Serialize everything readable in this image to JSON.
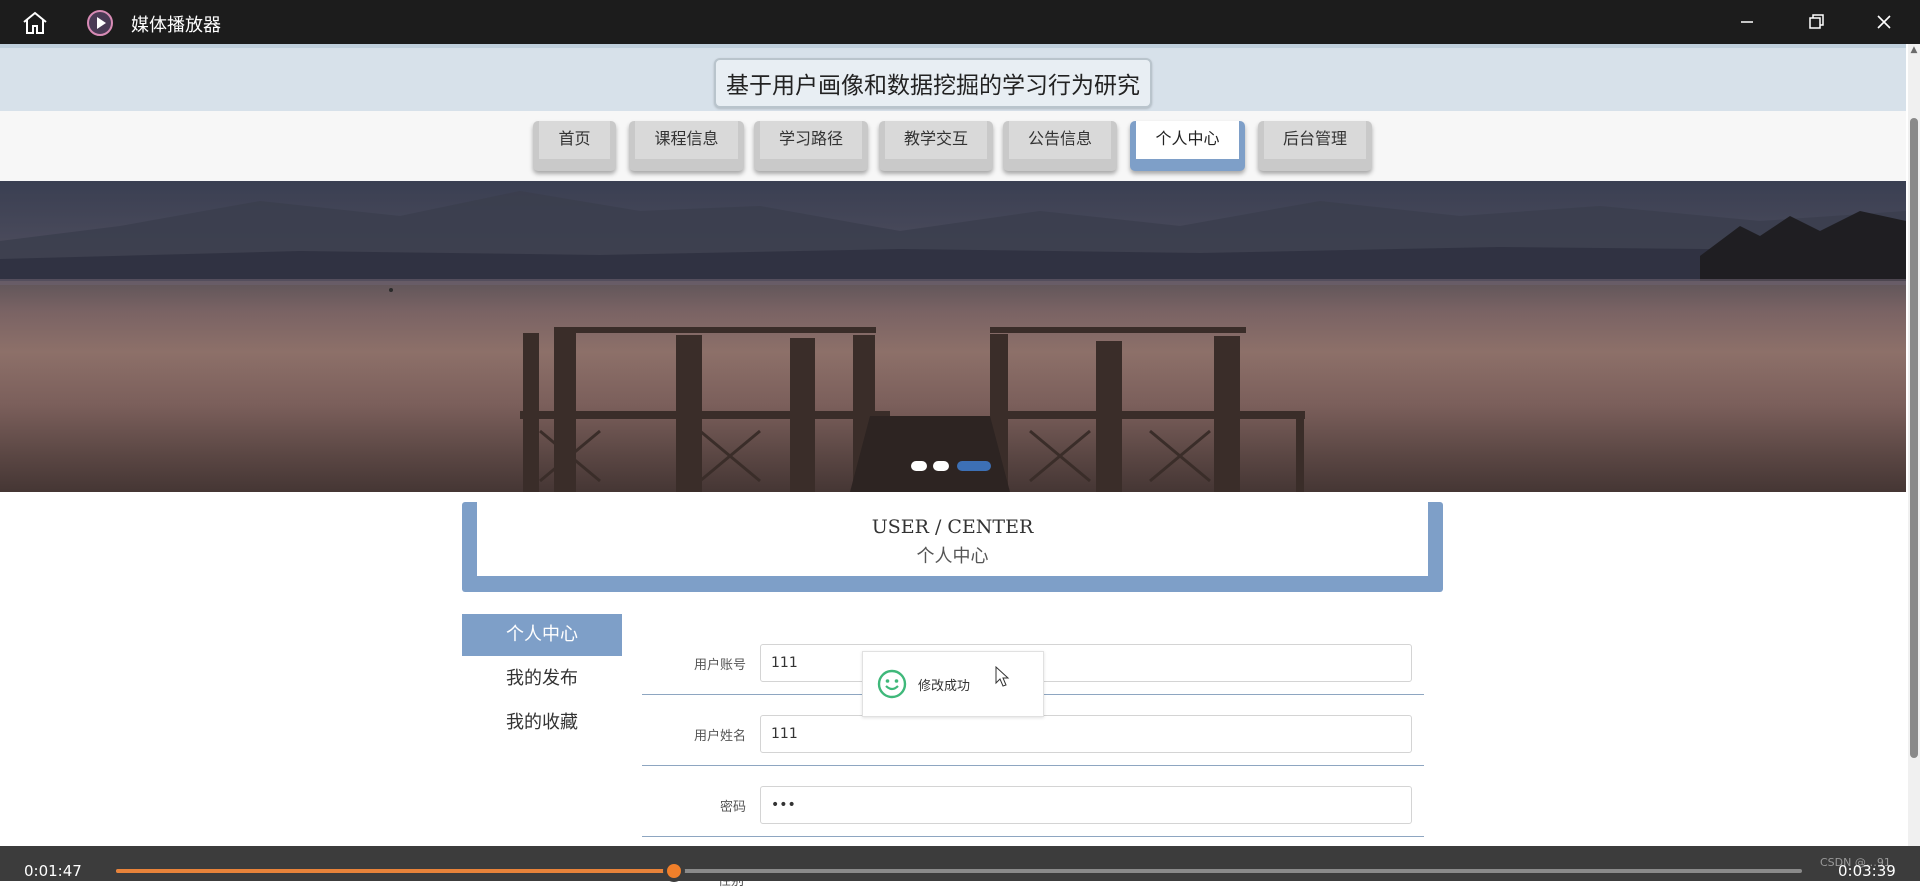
{
  "window": {
    "title": "媒体播放器",
    "home_icon": "home-icon",
    "app_icon": "media-player-icon",
    "controls": [
      "minimize-icon",
      "restore-icon",
      "close-icon"
    ]
  },
  "site": {
    "title": "基于用户画像和数据挖掘的学习行为研究"
  },
  "nav": {
    "items": [
      {
        "label": "首页"
      },
      {
        "label": "课程信息"
      },
      {
        "label": "学习路径"
      },
      {
        "label": "教学交互"
      },
      {
        "label": "公告信息"
      },
      {
        "label": "个人中心"
      },
      {
        "label": "后台管理"
      }
    ],
    "active_index": 5
  },
  "banner": {
    "slide_count": 3,
    "active_slide": 3
  },
  "section": {
    "title_en": "USER / CENTER",
    "title_cn": "个人中心"
  },
  "side_menu": {
    "items": [
      {
        "label": "个人中心"
      },
      {
        "label": "我的发布"
      },
      {
        "label": "我的收藏"
      }
    ],
    "active_index": 0
  },
  "form": {
    "fields": [
      {
        "label": "用户账号",
        "value": "111"
      },
      {
        "label": "用户姓名",
        "value": "111"
      },
      {
        "label": "密码",
        "value": "•••"
      }
    ],
    "next_label_partial": "性别"
  },
  "toast": {
    "message": "修改成功",
    "icon": "smile-icon"
  },
  "media": {
    "current_time": "0:01:47",
    "total_time": "0:03:39",
    "progress": 0.331,
    "watermark": "CSDN @…91"
  },
  "colors": {
    "accent": "#7e9fc8",
    "progress": "#f07f2a",
    "titlebar": "#1c1c1c"
  }
}
